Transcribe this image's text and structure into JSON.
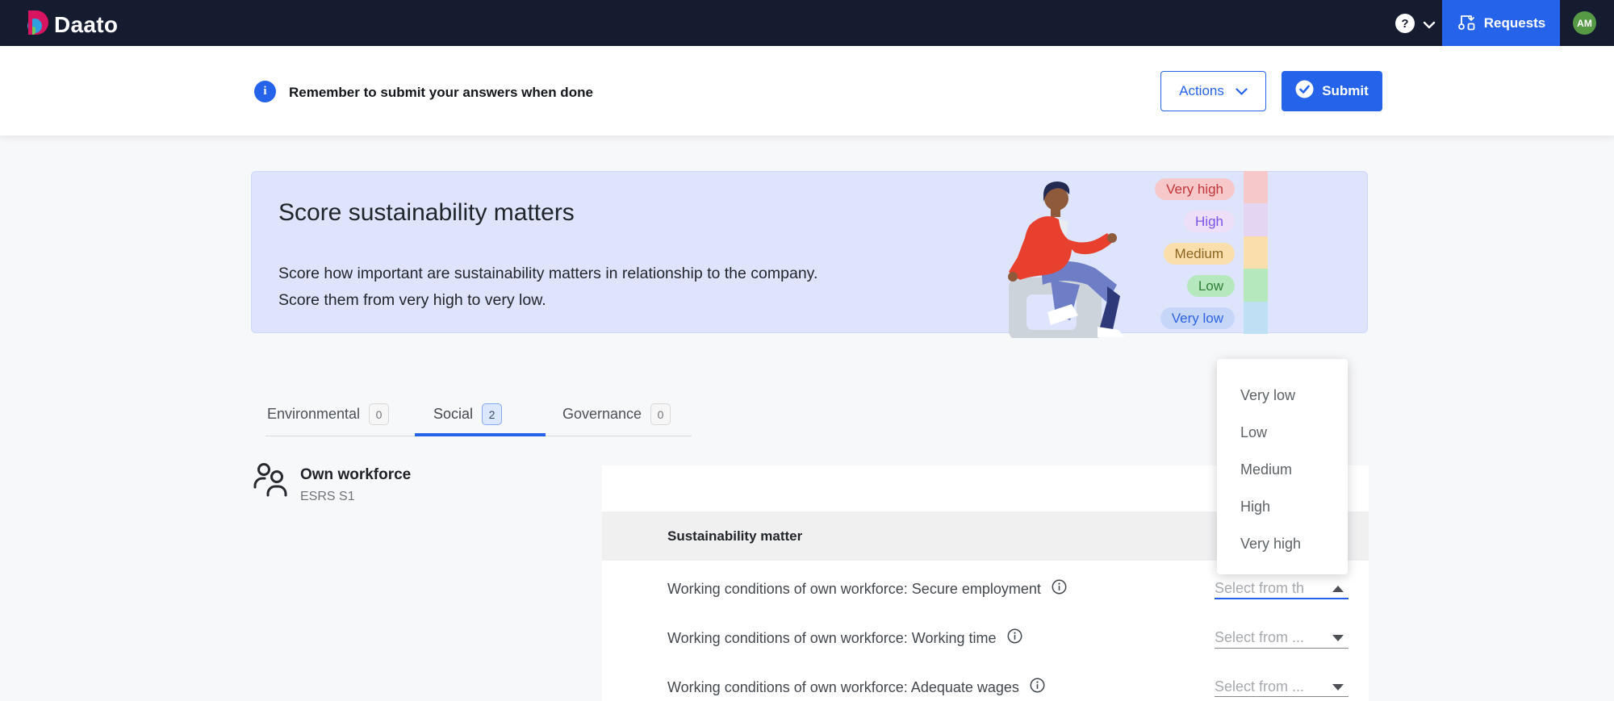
{
  "navbar": {
    "logo_text": "Daato",
    "help_label": "?",
    "requests_label": "Requests",
    "avatar_initials": "AM"
  },
  "header": {
    "info_glyph": "i",
    "message": "Remember to submit your answers when done",
    "actions_label": "Actions",
    "submit_label": "Submit"
  },
  "banner": {
    "title": "Score sustainability matters",
    "description_line1": "Score how important are sustainability matters in relationship to the company.",
    "description_line2": "Score them from very high to very low.",
    "legend": [
      {
        "label": "Very high",
        "chip_bg": "#f6c8ca",
        "chip_text": "#bf3538",
        "bar_color": "#f6c8ca"
      },
      {
        "label": "High",
        "chip_bg": "#ecdff7",
        "chip_text": "#7b52e8",
        "bar_color": "#e4d5f3"
      },
      {
        "label": "Medium",
        "chip_bg": "#fadfad",
        "chip_text": "#8c6420",
        "bar_color": "#fadfad"
      },
      {
        "label": "Low",
        "chip_bg": "#b5e8bc",
        "chip_text": "#2f7d37",
        "bar_color": "#b5e8bc"
      },
      {
        "label": "Very low",
        "chip_bg": "#c6d6f9",
        "chip_text": "#2d62e0",
        "bar_color": "#bfdff4"
      }
    ]
  },
  "tabs": {
    "items": [
      {
        "label": "Environmental",
        "count": "0",
        "active": false
      },
      {
        "label": "Social",
        "count": "2",
        "active": true
      },
      {
        "label": "Governance",
        "count": "0",
        "active": false
      }
    ]
  },
  "section": {
    "title": "Own workforce",
    "subtitle": "ESRS S1"
  },
  "table": {
    "header": "Sustainability matter",
    "rows": [
      {
        "label": "Working conditions of own workforce: Secure employment",
        "select_value": "Select from th",
        "select_state": "open-focused"
      },
      {
        "label": "Working conditions of own workforce: Working time",
        "select_value": "Select from ...",
        "select_state": "closed"
      },
      {
        "label": "Working conditions of own workforce: Adequate wages",
        "select_value": "Select from ...",
        "select_state": "closed"
      }
    ]
  },
  "dropdown": {
    "options": [
      "Very low",
      "Low",
      "Medium",
      "High",
      "Very high"
    ]
  },
  "colors": {
    "navbar_bg": "#161c30",
    "accent_blue": "#2563eb",
    "banner_bg": "#dde4fb",
    "page_bg": "#f7f8fa",
    "table_header_bg": "#f0f0f1",
    "avatar_green": "#579a46"
  }
}
